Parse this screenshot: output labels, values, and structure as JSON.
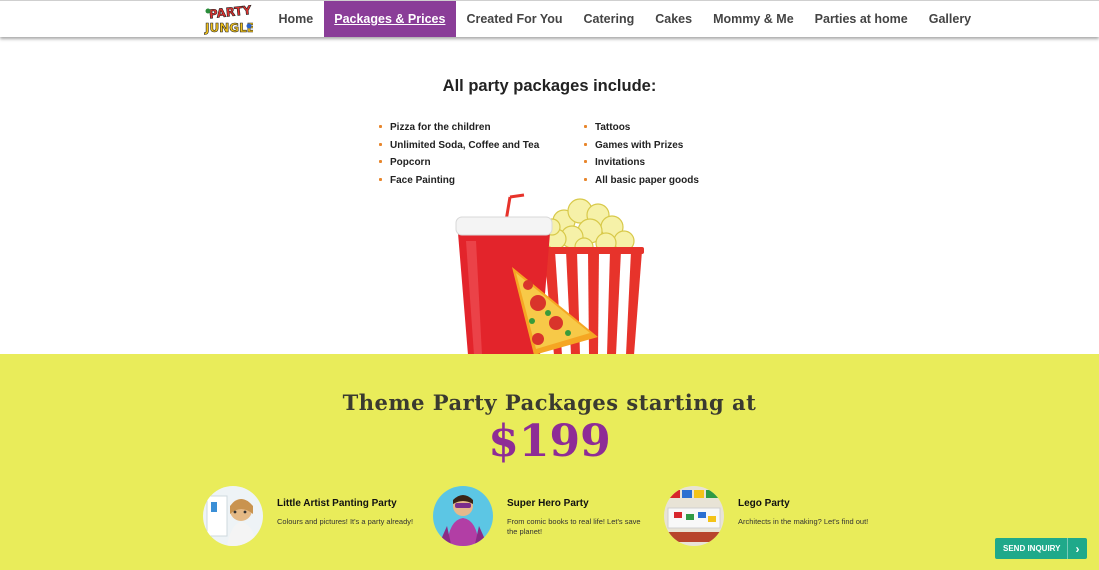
{
  "header": {
    "logo_text_line1": "PARTY",
    "logo_text_line2": "JUNGLE",
    "nav": [
      {
        "label": "Home"
      },
      {
        "label": "Packages & Prices",
        "active": true
      },
      {
        "label": "Created For You"
      },
      {
        "label": "Catering"
      },
      {
        "label": "Cakes"
      },
      {
        "label": "Mommy & Me"
      },
      {
        "label": "Parties at home"
      },
      {
        "label": "Gallery"
      }
    ],
    "active_color": "#8a3d98"
  },
  "includes": {
    "title": "All party packages include:",
    "left": [
      "Pizza for the children",
      "Unlimited Soda, Coffee and Tea",
      "Popcorn",
      "Face Painting"
    ],
    "right": [
      "Tattoos",
      "Games with Prizes",
      "Invitations",
      "All basic paper goods"
    ],
    "bullet_color": "#e8862c",
    "illustration_icon": "soda-popcorn-pizza-illustration"
  },
  "theme": {
    "heading": "Theme Party Packages starting at",
    "price": "$199",
    "background": "#e9ec5a",
    "price_color": "#8e2c96",
    "packages": [
      {
        "title": "Little Artist Panting Party",
        "desc": "Colours and pictures! It's a party already!",
        "icon": "child-painting-photo"
      },
      {
        "title": "Super Hero Party",
        "desc": "From comic books to real life! Let's save the planet!",
        "icon": "superhero-girl-photo"
      },
      {
        "title": "Lego Party",
        "desc": "Architects in the making? Let's find out!",
        "icon": "lego-table-photo"
      }
    ]
  },
  "inquiry": {
    "label": "SEND INQUIRY",
    "icon": "chevron-right-icon",
    "color": "#1fa98a"
  }
}
